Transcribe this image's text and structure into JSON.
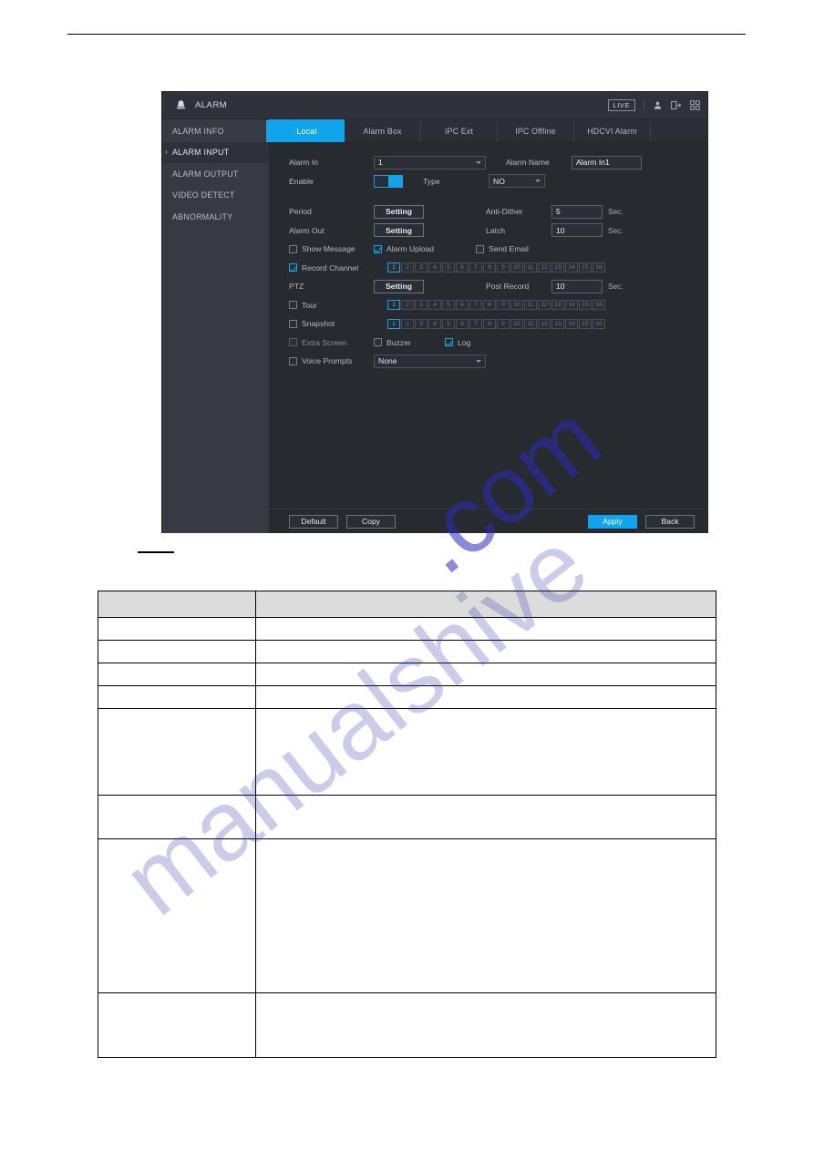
{
  "document": {
    "caption_placeholder": "",
    "watermark_a": "manualshive",
    "watermark_b": ".com"
  },
  "nvr": {
    "title": "ALARM",
    "title_icon": "bell-icon",
    "status": {
      "live_badge": "LIVE",
      "icons": [
        "user-icon",
        "logout-icon",
        "grid-icon"
      ]
    },
    "sidebar": {
      "items": [
        {
          "label": "ALARM INFO",
          "active": false,
          "expanded": false
        },
        {
          "label": "ALARM INPUT",
          "active": true,
          "expanded": true
        },
        {
          "label": "ALARM OUTPUT",
          "active": false,
          "expanded": false
        },
        {
          "label": "VIDEO DETECT",
          "active": false,
          "expanded": false
        },
        {
          "label": "ABNORMALITY",
          "active": false,
          "expanded": false
        }
      ]
    },
    "tabs": [
      {
        "label": "Local",
        "active": true
      },
      {
        "label": "Alarm Box",
        "active": false
      },
      {
        "label": "IPC Ext",
        "active": false
      },
      {
        "label": "IPC Offline",
        "active": false
      },
      {
        "label": "HDCVI Alarm",
        "active": false
      }
    ],
    "form": {
      "alarm_in_label": "Alarm In",
      "alarm_in_value": "1",
      "alarm_name_label": "Alarm Name",
      "alarm_name_value": "Alarm In1",
      "enable_label": "Enable",
      "enable_on": true,
      "type_label": "Type",
      "type_value": "NO",
      "period_label": "Period",
      "period_button": "Setting",
      "anti_dither_label": "Anti-Dither",
      "anti_dither_value": "5",
      "anti_dither_unit": "Sec.",
      "alarm_out_label": "Alarm Out",
      "alarm_out_button": "Setting",
      "latch_label": "Latch",
      "latch_value": "10",
      "latch_unit": "Sec.",
      "show_message_label": "Show Message",
      "show_message_checked": false,
      "alarm_upload_label": "Alarm Upload",
      "alarm_upload_checked": true,
      "send_email_label": "Send Email",
      "send_email_checked": false,
      "record_channel_label": "Record Channel",
      "record_channel_checked": true,
      "ptz_label": "PTZ",
      "ptz_button": "Setting",
      "post_record_label": "Post Record",
      "post_record_value": "10",
      "post_record_unit": "Sec.",
      "tour_label": "Tour",
      "tour_checked": false,
      "snapshot_label": "Snapshot",
      "snapshot_checked": false,
      "extra_screen_label": "Extra Screen",
      "extra_screen_checked": false,
      "buzzer_label": "Buzzer",
      "buzzer_checked": false,
      "log_label": "Log",
      "log_checked": true,
      "voice_prompts_label": "Voice Prompts",
      "voice_prompts_checked": false,
      "voice_prompts_value": "None",
      "channels": [
        "1",
        "2",
        "3",
        "4",
        "5",
        "6",
        "7",
        "8",
        "9",
        "10",
        "11",
        "12",
        "13",
        "14",
        "15",
        "16"
      ],
      "channels_selected": [
        "1"
      ]
    },
    "footer": {
      "default_label": "Default",
      "copy_label": "Copy",
      "apply_label": "Apply",
      "back_label": "Back"
    },
    "colors": {
      "accent": "#0fa4ec",
      "panel_bg": "#272a2f",
      "sidebar_bg": "#373a42",
      "titlebar_bg": "#2f3238",
      "text": "#c6cbd2"
    }
  },
  "table": {
    "header": [
      "",
      ""
    ],
    "rows": [
      [
        "",
        ""
      ],
      [
        "",
        ""
      ],
      [
        "",
        ""
      ],
      [
        "",
        ""
      ],
      [
        "",
        ""
      ],
      [
        "",
        ""
      ],
      [
        "",
        ""
      ],
      [
        "",
        ""
      ]
    ]
  }
}
